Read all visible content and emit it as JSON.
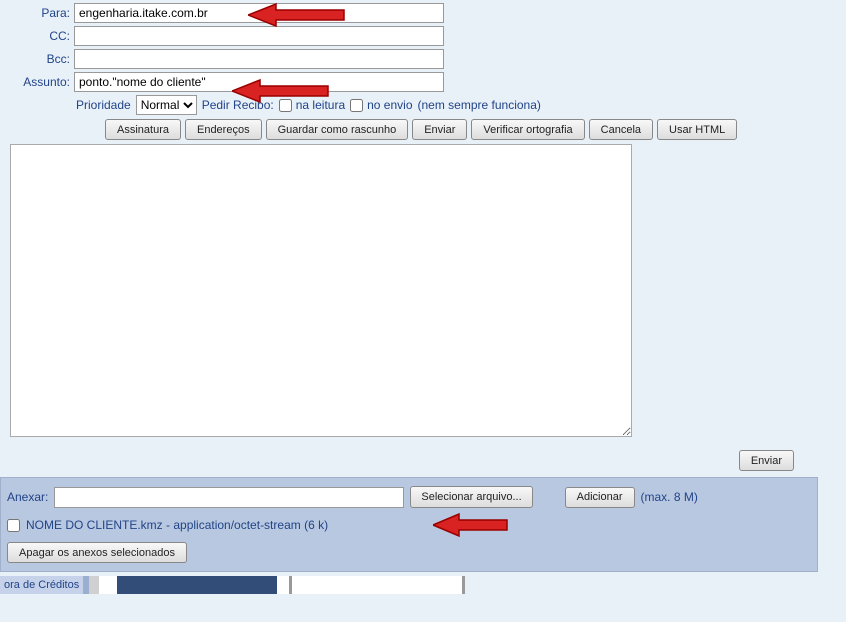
{
  "fields": {
    "to": {
      "label": "Para:",
      "value": "engenharia.itake.com.br"
    },
    "cc": {
      "label": "CC:",
      "value": ""
    },
    "bcc": {
      "label": "Bcc:",
      "value": ""
    },
    "subject": {
      "label": "Assunto:",
      "value": "ponto.\"nome do cliente\""
    }
  },
  "options": {
    "priority_label": "Prioridade",
    "priority_value": "Normal",
    "receipt_label": "Pedir Recibo:",
    "on_read": "na leitura",
    "on_send": "no envio",
    "on_send_note": "(nem sempre funciona)"
  },
  "toolbar": {
    "signature": "Assinatura",
    "addresses": "Endereços",
    "save_draft": "Guardar como rascunho",
    "send": "Enviar",
    "spellcheck": "Verificar ortografia",
    "cancel": "Cancela",
    "use_html": "Usar HTML"
  },
  "body": "",
  "send2": "Enviar",
  "attach": {
    "label": "Anexar:",
    "choose": "Selecionar arquivo...",
    "add": "Adicionar",
    "max": "(max. 8 M)",
    "item": "NOME DO CLIENTE.kmz - application/octet-stream (6 k)",
    "delete_selected": "Apagar os anexos selecionados"
  },
  "footer": {
    "credits": "ora de Créditos"
  }
}
